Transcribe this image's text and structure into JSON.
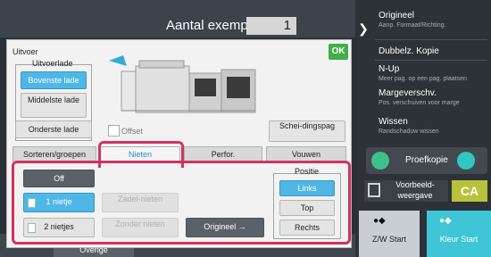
{
  "top": {
    "copies_label": "Aantal exempl.",
    "copies_value": "1"
  },
  "right_panel": {
    "items": [
      {
        "title": "Origineel",
        "sub": "Aanp. Formaat/Richting."
      },
      {
        "title": "Dubbelz. Kopie",
        "sub": ""
      },
      {
        "title": "N-Up",
        "sub": "Meer pag. op een pag. plaatsen"
      },
      {
        "title": "Margeverschv.",
        "sub": "Pos. verschuiven voor marge"
      },
      {
        "title": "Wissen",
        "sub": "Randschaduw wissen"
      }
    ],
    "proof_label": "Proefkopie",
    "preview_label": "Voorbeeld-weergave",
    "ca_label": "CA",
    "bw_label": "Z/W Start",
    "color_label": "Kleur Start"
  },
  "bottom": {
    "other_label": "Overige"
  },
  "dialog": {
    "title": "Uitvoer",
    "ok_label": "OK",
    "tray_group_label": "Uitvoerlade",
    "trays": [
      "Bovenste lade",
      "Middelste lade",
      "Onderste lade"
    ],
    "offset_label": "Offset",
    "separator_label": "Schei-dingspag",
    "tabs": [
      "Sorteren/groepen",
      "Nieten",
      "Perfor.",
      "Vouwen"
    ],
    "staple_options": [
      "Off",
      "1 nietje",
      "2 nietjes"
    ],
    "disabled_options": [
      "Zadel-nieten",
      "Zonder nieten"
    ],
    "original_label": "Origineel",
    "position_label": "Positie",
    "positions": [
      "Links",
      "Top",
      "Rechts"
    ]
  }
}
